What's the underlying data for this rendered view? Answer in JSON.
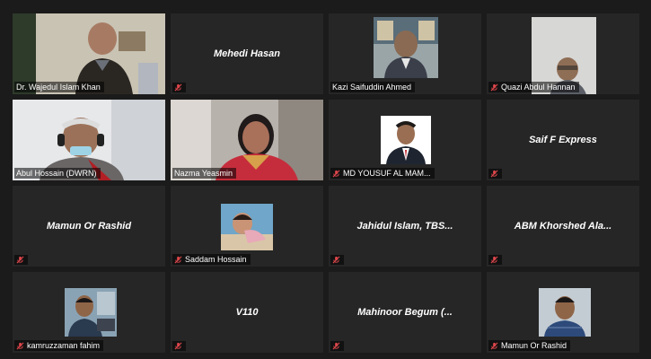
{
  "participants": [
    {
      "name": "Dr. Wajedul Islam Khan",
      "display": "video",
      "muted": false,
      "active": true
    },
    {
      "name": "Mehedi Hasan",
      "display": "name",
      "muted": true
    },
    {
      "name": "Kazi Saifuddin Ahmed",
      "display": "photo",
      "muted": false
    },
    {
      "name": "Quazi Abdul Hannan",
      "display": "photo",
      "muted": true
    },
    {
      "name": "Abul Hossain (DWRN)",
      "display": "video",
      "muted": false
    },
    {
      "name": "Nazma Yeasmin",
      "display": "video",
      "muted": false
    },
    {
      "name": "MD YOUSUF AL MAM...",
      "display": "photo",
      "muted": true
    },
    {
      "name": "Saif F Express",
      "display": "name",
      "muted": true
    },
    {
      "name": "Mamun Or Rashid",
      "display": "name",
      "muted": true
    },
    {
      "name": "Saddam Hossain",
      "display": "photo",
      "muted": true
    },
    {
      "name": "Jahidul Islam, TBS...",
      "display": "name",
      "muted": true
    },
    {
      "name": "ABM Khorshed Ala...",
      "display": "name",
      "muted": true
    },
    {
      "name": "kamruzzaman fahim",
      "display": "photo",
      "muted": true
    },
    {
      "name": "V110",
      "display": "name",
      "muted": true
    },
    {
      "name": "Mahinoor Begum (...",
      "display": "name",
      "muted": true
    },
    {
      "name": "Mamun Or Rashid",
      "display": "photo",
      "muted": true
    }
  ],
  "colors": {
    "active_speaker_outline": "#d9d75a",
    "muted_icon": "#e0474c",
    "tile_bg": "#262626"
  },
  "icons": {
    "muted": "mic-muted-icon"
  }
}
